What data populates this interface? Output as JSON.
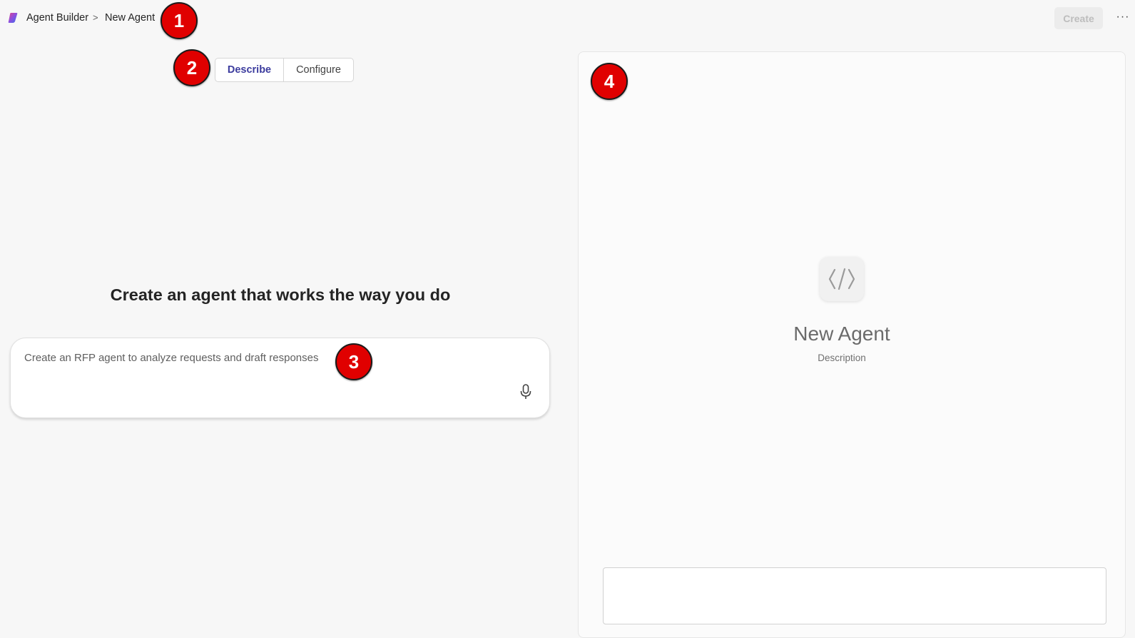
{
  "header": {
    "breadcrumb_root": "Agent Builder",
    "breadcrumb_separator": ">",
    "breadcrumb_current": "New Agent",
    "create_label": "Create",
    "more_label": "···"
  },
  "tabs": [
    {
      "label": "Describe",
      "selected": true
    },
    {
      "label": "Configure",
      "selected": false
    }
  ],
  "main": {
    "heading": "Create an agent that works the way you do",
    "prompt_text": "Create an RFP agent to analyze requests and draft responses"
  },
  "preview": {
    "agent_name": "New Agent",
    "agent_description": "Description",
    "chat_input_value": ""
  },
  "markers": [
    "1",
    "2",
    "3",
    "4"
  ],
  "colors": {
    "accent": "#3c3c9e",
    "marker": "#e00000",
    "background": "#f7f7f7"
  },
  "icons": {
    "app_logo": "copilot-logo-icon",
    "microphone": "microphone-icon",
    "agent": "code-brackets-icon"
  }
}
